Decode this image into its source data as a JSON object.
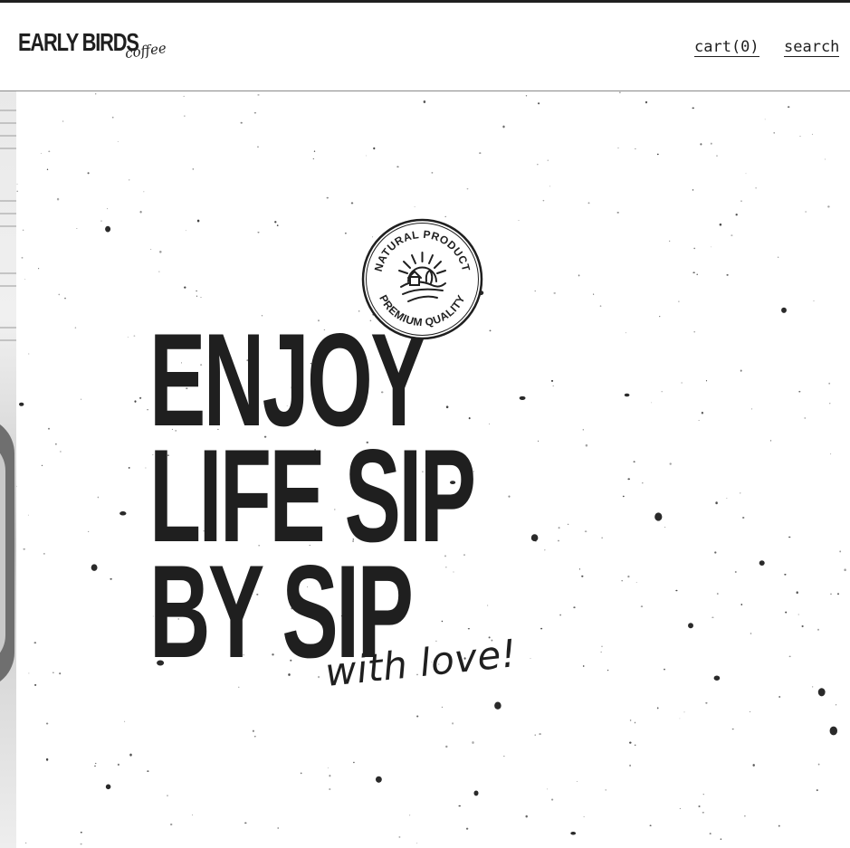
{
  "header": {
    "logo_main": "EARLY BIRDS",
    "logo_script": "coffee",
    "cart_label": "cart(0)",
    "search_label": "search"
  },
  "hero": {
    "headline": [
      "ENJOY",
      "LIFE SIP",
      "BY SIP"
    ],
    "tagline": "with love!",
    "badge": {
      "top_text": "NATURAL PRODUCT",
      "bottom_text": "PREMIUM QUALITY"
    }
  },
  "colors": {
    "ink": "#1f1f1f",
    "background": "#ffffff",
    "divider": "#8a8a8a"
  }
}
